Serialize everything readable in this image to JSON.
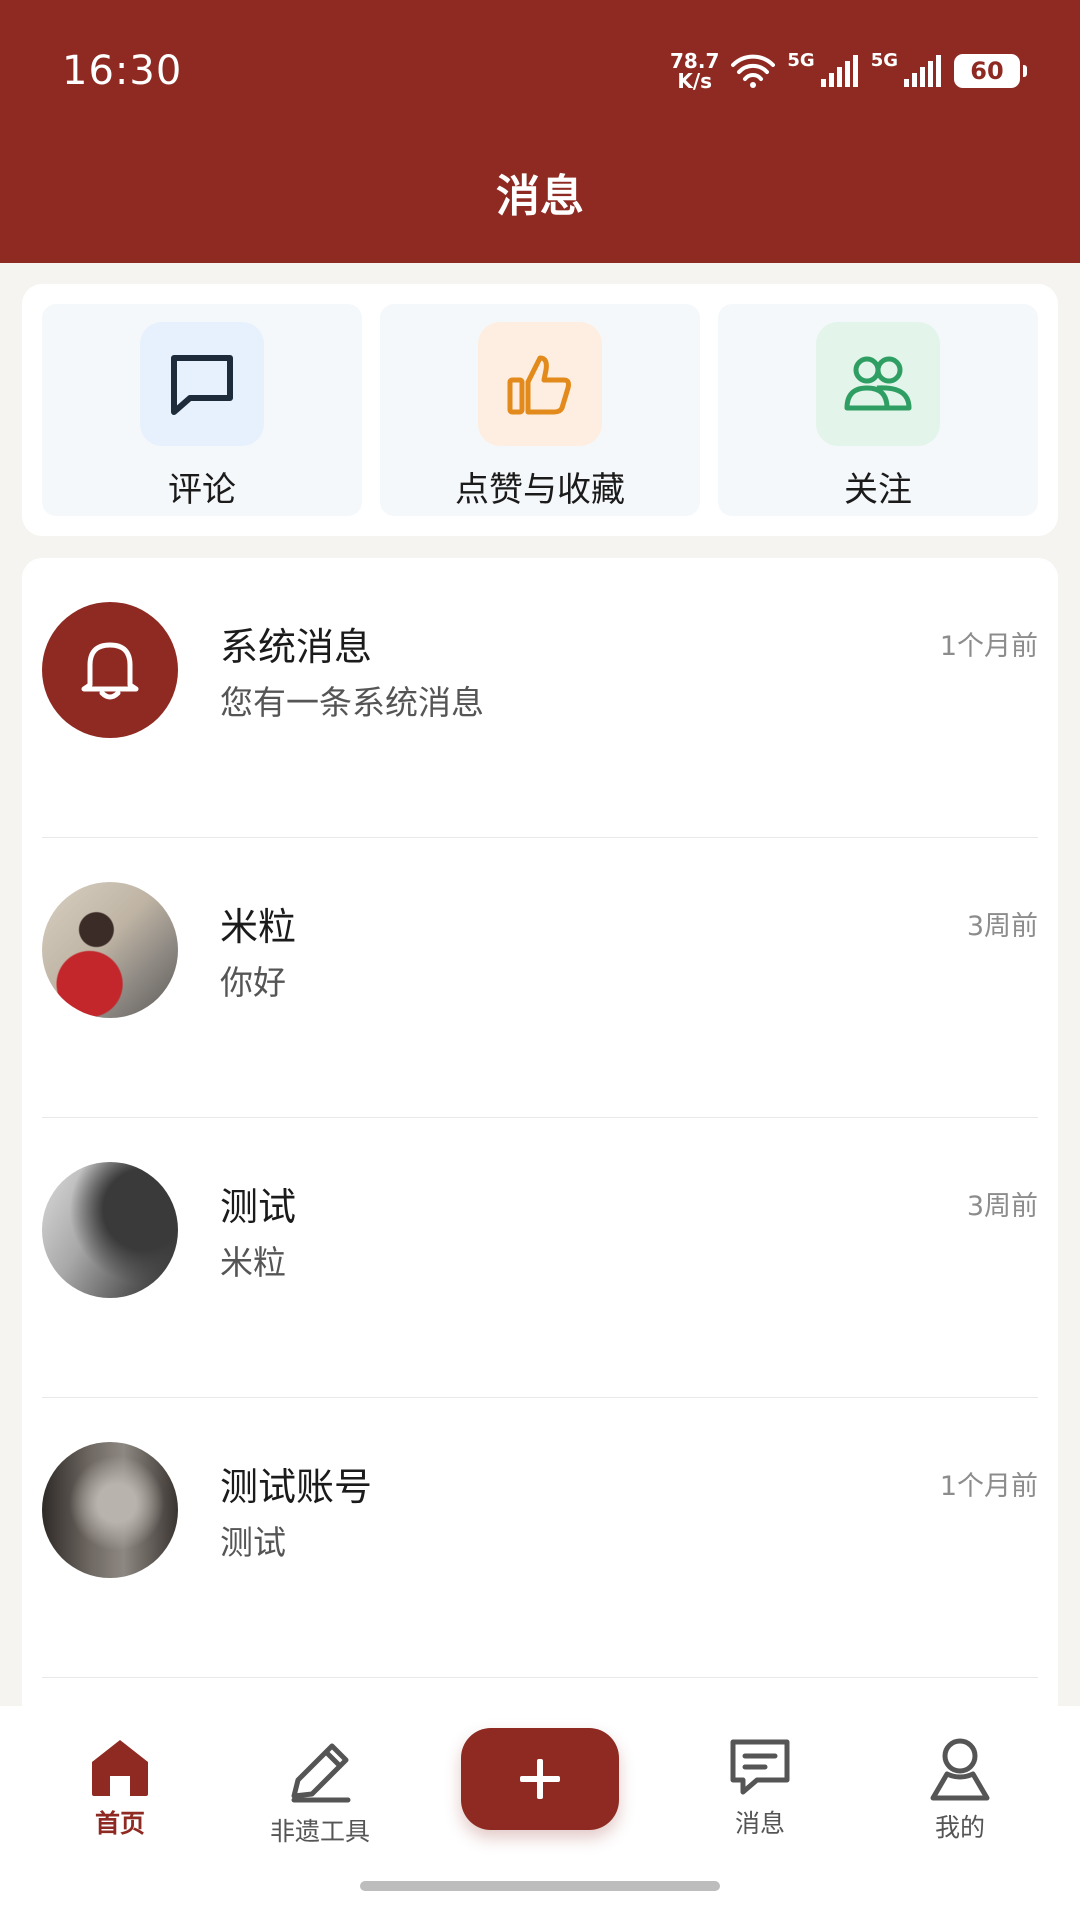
{
  "status_bar": {
    "time": "16:30",
    "net_speed_value": "78.7",
    "net_speed_unit": "K/s",
    "signal_1": "5G",
    "signal_2": "5G",
    "battery": "60"
  },
  "header": {
    "title": "消息"
  },
  "shortcuts": [
    {
      "label": "评论",
      "icon": "comment-icon",
      "bg": "#e6f1fd",
      "color": "#1d2b3a"
    },
    {
      "label": "点赞与收藏",
      "icon": "thumbs-up-icon",
      "bg": "#fdeee1",
      "color": "#e38a1c"
    },
    {
      "label": "关注",
      "icon": "users-icon",
      "bg": "#e3f4ea",
      "color": "#2f9e63"
    }
  ],
  "messages": [
    {
      "name": "系统消息",
      "preview": "您有一条系统消息",
      "time": "1个月前",
      "avatar": "bell-icon"
    },
    {
      "name": "米粒",
      "preview": "你好",
      "time": "3周前",
      "avatar": "photo"
    },
    {
      "name": "测试",
      "preview": "米粒",
      "time": "3周前",
      "avatar": "photo"
    },
    {
      "name": "测试账号",
      "preview": "测试",
      "time": "1个月前",
      "avatar": "photo"
    }
  ],
  "bottom_nav": {
    "items": [
      {
        "label": "首页",
        "icon": "home-icon",
        "active": true
      },
      {
        "label": "非遗工具",
        "icon": "pencil-icon",
        "active": false
      },
      {
        "label": "",
        "icon": "plus-icon",
        "active": false
      },
      {
        "label": "消息",
        "icon": "message-icon",
        "active": false
      },
      {
        "label": "我的",
        "icon": "user-icon",
        "active": false
      }
    ]
  },
  "colors": {
    "brand": "#8e2a22",
    "background": "#f6f4f1"
  }
}
